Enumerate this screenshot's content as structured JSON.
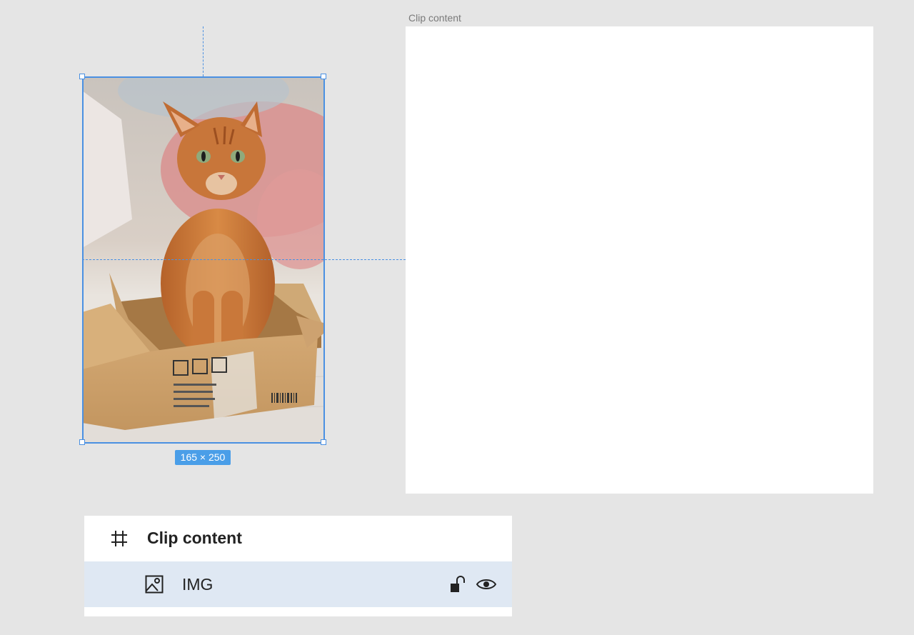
{
  "canvas": {
    "frame_label": "Clip content",
    "selection_size": "165 × 250",
    "image_subject": "orange cat sitting in cardboard box"
  },
  "layers": {
    "frame_layer_name": "Clip content",
    "frame_icon": "hash-frame-icon",
    "image_layer_name": "IMG",
    "image_icon": "image-icon",
    "lock_icon": "unlock-icon",
    "visibility_icon": "eye-icon"
  },
  "colors": {
    "canvas_bg": "#e5e5e5",
    "selection": "#4a90e2",
    "badge": "#4a9ee8",
    "selected_row": "#dfe8f3"
  }
}
